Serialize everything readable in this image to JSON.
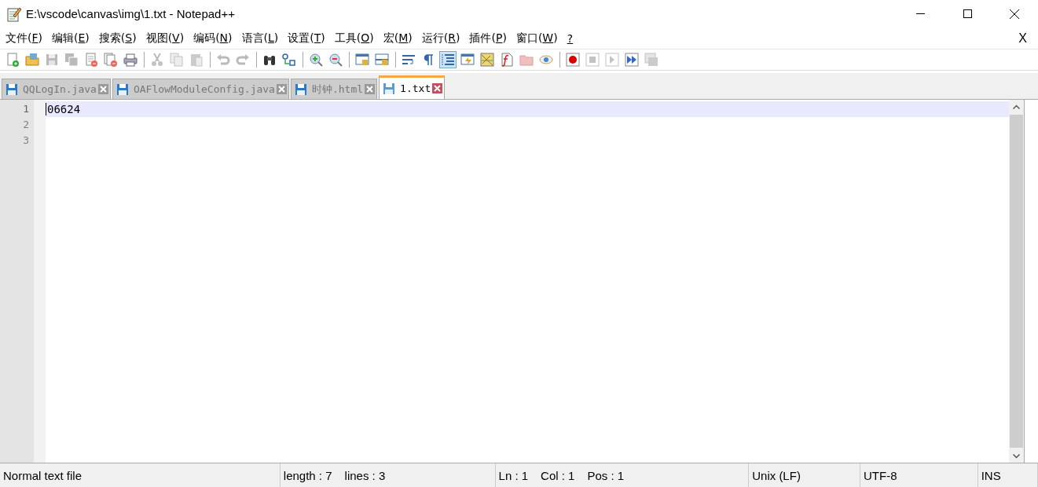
{
  "window": {
    "title": "E:\\vscode\\canvas\\img\\1.txt - Notepad++"
  },
  "menu": {
    "items": [
      "文件(F)",
      "编辑(E)",
      "搜索(S)",
      "视图(V)",
      "编码(N)",
      "语言(L)",
      "设置(T)",
      "工具(O)",
      "宏(M)",
      "运行(R)",
      "插件(P)",
      "窗口(W)",
      "?"
    ],
    "close_label": "X"
  },
  "toolbar": [
    [
      {
        "kind": "new",
        "pressed": false,
        "disabled": false
      },
      {
        "kind": "open",
        "pressed": false,
        "disabled": false
      },
      {
        "kind": "save",
        "pressed": false,
        "disabled": true
      },
      {
        "kind": "saveall",
        "pressed": false,
        "disabled": true
      },
      {
        "kind": "close",
        "pressed": false,
        "disabled": false
      },
      {
        "kind": "closeall",
        "pressed": false,
        "disabled": false
      },
      {
        "kind": "print",
        "pressed": false,
        "disabled": false
      }
    ],
    [
      {
        "kind": "cut",
        "pressed": false,
        "disabled": true
      },
      {
        "kind": "copy",
        "pressed": false,
        "disabled": true
      },
      {
        "kind": "paste",
        "pressed": false,
        "disabled": true
      }
    ],
    [
      {
        "kind": "undo",
        "pressed": false,
        "disabled": true
      },
      {
        "kind": "redo",
        "pressed": false,
        "disabled": true
      }
    ],
    [
      {
        "kind": "find",
        "pressed": false,
        "disabled": false
      },
      {
        "kind": "replace",
        "pressed": false,
        "disabled": false
      }
    ],
    [
      {
        "kind": "zoomin",
        "pressed": false,
        "disabled": false
      },
      {
        "kind": "zoomout",
        "pressed": false,
        "disabled": false
      }
    ],
    [
      {
        "kind": "syncv",
        "pressed": false,
        "disabled": false
      },
      {
        "kind": "synch",
        "pressed": false,
        "disabled": false
      }
    ],
    [
      {
        "kind": "wrap",
        "pressed": false,
        "disabled": false
      },
      {
        "kind": "allchars",
        "pressed": false,
        "disabled": false
      },
      {
        "kind": "indent",
        "pressed": true,
        "disabled": false
      },
      {
        "kind": "udl",
        "pressed": false,
        "disabled": false
      },
      {
        "kind": "docmap",
        "pressed": false,
        "disabled": false
      },
      {
        "kind": "funclist",
        "pressed": false,
        "disabled": false
      },
      {
        "kind": "folder",
        "pressed": false,
        "disabled": false
      },
      {
        "kind": "monitor",
        "pressed": false,
        "disabled": false
      }
    ],
    [
      {
        "kind": "record",
        "pressed": false,
        "disabled": false
      },
      {
        "kind": "stop",
        "pressed": false,
        "disabled": true
      },
      {
        "kind": "play",
        "pressed": false,
        "disabled": true
      },
      {
        "kind": "playmulti",
        "pressed": false,
        "disabled": false
      },
      {
        "kind": "savemacro",
        "pressed": false,
        "disabled": true
      }
    ]
  ],
  "tabs": [
    {
      "label": "QQLogIn.java",
      "selected": false
    },
    {
      "label": "OAFlowModuleConfig.java",
      "selected": false
    },
    {
      "label": "时钟.html",
      "selected": false
    },
    {
      "label": "1.txt",
      "selected": true
    }
  ],
  "editor": {
    "lines": [
      {
        "number": "1",
        "text": "06624",
        "current": true
      },
      {
        "number": "2",
        "current": false
      },
      {
        "number": "3",
        "current": false
      }
    ]
  },
  "status_bar": {
    "file_type": "Normal text file",
    "length": "length : 7",
    "lines": "lines : 3",
    "ln": "Ln : 1",
    "col": "Col : 1",
    "pos": "Pos : 1",
    "eol": "Unix (LF)",
    "encoding": "UTF-8",
    "mode": "INS"
  }
}
